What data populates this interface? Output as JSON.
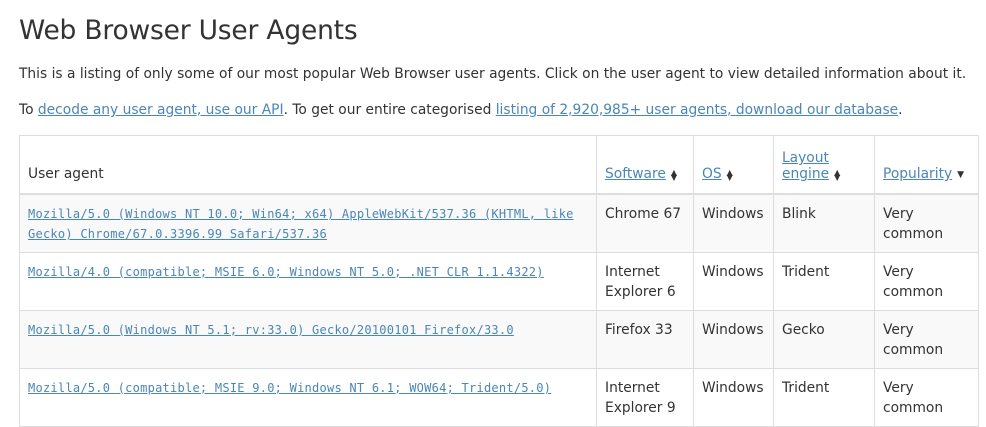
{
  "page": {
    "title": "Web Browser User Agents",
    "intro": "This is a listing of only some of our most popular Web Browser user agents. Click on the user agent to view detailed information about it.",
    "links_prefix": "To ",
    "api_link": "decode any user agent, use our API",
    "links_middle": ". To get our entire categorised ",
    "database_link": "listing of 2,920,985+ user agents, download our database",
    "links_suffix": "."
  },
  "table": {
    "headers": {
      "user_agent": "User agent",
      "software": "Software",
      "os": "OS",
      "layout_engine_line1": "Layout",
      "layout_engine_line2": "engine",
      "popularity": "Popularity"
    },
    "sort_icons": {
      "software": "sort-both-icon",
      "os": "sort-both-icon",
      "layout_engine": "sort-both-icon",
      "popularity": "sort-desc-icon"
    },
    "rows": [
      {
        "user_agent": "Mozilla/5.0 (Windows NT 10.0; Win64; x64) AppleWebKit/537.36 (KHTML, like Gecko) Chrome/67.0.3396.99 Safari/537.36",
        "software": "Chrome 67",
        "os": "Windows",
        "engine": "Blink",
        "popularity": "Very common"
      },
      {
        "user_agent": "Mozilla/4.0 (compatible; MSIE 6.0; Windows NT 5.0; .NET CLR 1.1.4322)",
        "software": "Internet Explorer 6",
        "os": "Windows",
        "engine": "Trident",
        "popularity": "Very common"
      },
      {
        "user_agent": "Mozilla/5.0 (Windows NT 5.1; rv:33.0) Gecko/20100101 Firefox/33.0",
        "software": "Firefox 33",
        "os": "Windows",
        "engine": "Gecko",
        "popularity": "Very common"
      },
      {
        "user_agent": "Mozilla/5.0 (compatible; MSIE 9.0; Windows NT 6.1; WOW64; Trident/5.0)",
        "software": "Internet Explorer 9",
        "os": "Windows",
        "engine": "Trident",
        "popularity": "Very common"
      }
    ]
  },
  "colors": {
    "link": "#4a86b8",
    "text": "#333333",
    "border": "#dddddd",
    "stripe": "#f9f9f9"
  }
}
